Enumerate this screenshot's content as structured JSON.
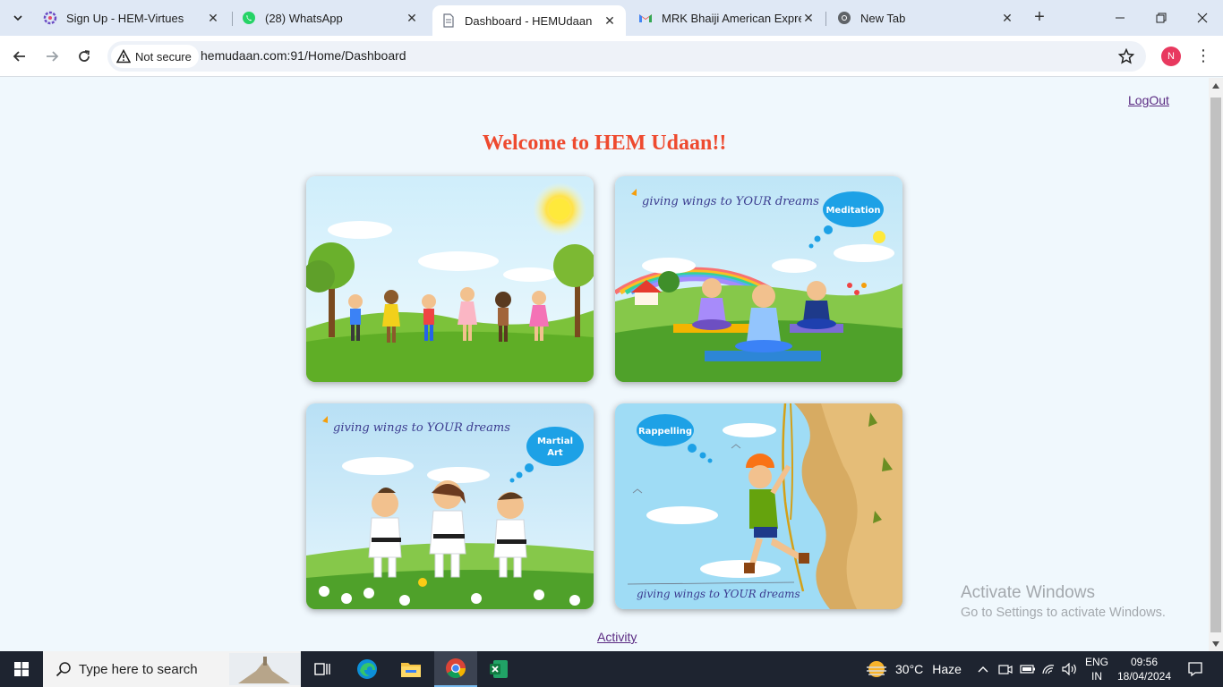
{
  "tabs": [
    {
      "title": "Sign Up - HEM-Virtues",
      "favicon": "gear-flower-icon",
      "active": false
    },
    {
      "title": "(28) WhatsApp",
      "favicon": "whatsapp-icon",
      "active": false
    },
    {
      "title": "Dashboard - HEMUdaan",
      "favicon": "document-icon",
      "active": true
    },
    {
      "title": "MRK Bhaiji American Expre",
      "favicon": "gmail-icon",
      "active": false
    },
    {
      "title": "New Tab",
      "favicon": "chrome-icon",
      "active": false
    }
  ],
  "toolbar": {
    "security_label": "Not secure",
    "url": "hemudaan.com:91/Home/Dashboard",
    "profile_initial": "N"
  },
  "page": {
    "logout_label": "LogOut",
    "welcome_title": "Welcome to HEM Udaan!!",
    "cards": [
      {
        "name": "kids-playing",
        "text": []
      },
      {
        "name": "meditation",
        "banner": "giving wings to YOUR dreams",
        "bubble": "Meditation"
      },
      {
        "name": "martial-art",
        "banner": "giving wings to YOUR dreams",
        "bubble_line1": "Martial",
        "bubble_line2": "Art"
      },
      {
        "name": "rappelling",
        "banner": "giving wings to YOUR dreams",
        "bubble": "Rappelling"
      }
    ],
    "activity_label": "Activity",
    "watermark_line1": "Activate Windows",
    "watermark_line2": "Go to Settings to activate Windows."
  },
  "taskbar": {
    "search_placeholder": "Type here to search",
    "weather_temp": "30°C",
    "weather_desc": "Haze",
    "lang_line1": "ENG",
    "lang_line2": "IN",
    "time": "09:56",
    "date": "18/04/2024"
  },
  "colors": {
    "welcome": "#ee4a2f",
    "link": "#5a2a82",
    "page_bg": "#f0f8fd",
    "taskbar_bg": "#1e2430"
  }
}
